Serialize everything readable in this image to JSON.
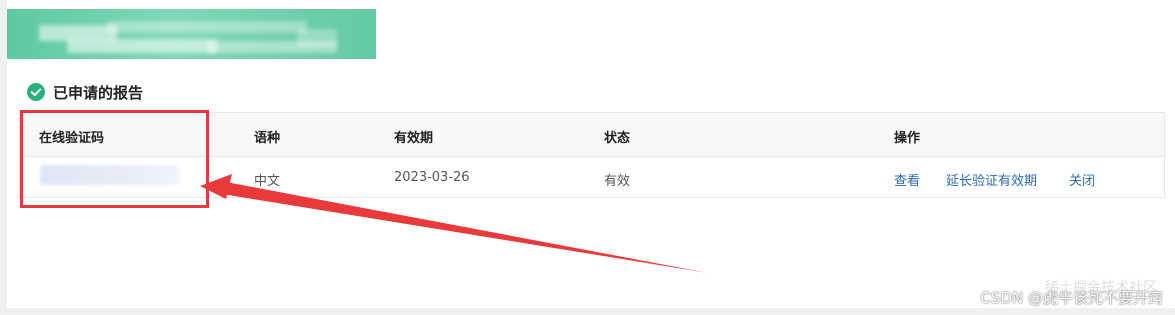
{
  "section": {
    "title": "已申请的报告"
  },
  "table": {
    "headers": [
      "在线验证码",
      "语种",
      "有效期",
      "状态",
      "操作"
    ],
    "rows": [
      {
        "code": "",
        "language": "中文",
        "valid_until": "2023-03-26",
        "status": "有效",
        "actions": [
          "查看",
          "延长验证有效期",
          "关闭"
        ]
      }
    ]
  },
  "watermark": {
    "text": "CSDN @虎牛该死不要开窍",
    "overlay": "稀土掘金技术社区"
  },
  "colors": {
    "accent": "#2ab27b",
    "banner": "#63caa2",
    "link": "#2a6bb5",
    "annotation": "#e8393b"
  }
}
